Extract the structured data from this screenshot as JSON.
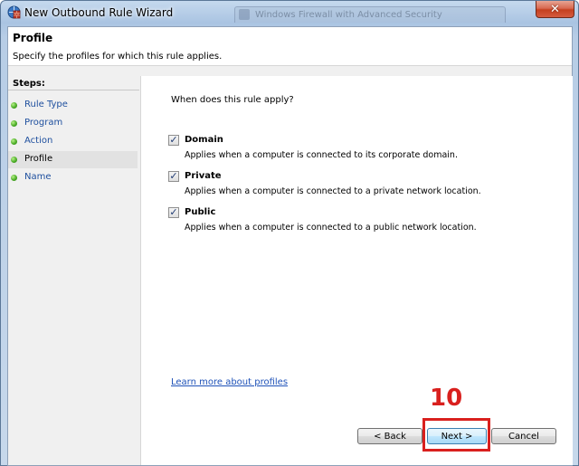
{
  "window": {
    "title": "New Outbound Rule Wizard",
    "background_window_title": "Windows Firewall with Advanced Security",
    "close_label": "✕"
  },
  "header": {
    "title": "Profile",
    "subtitle": "Specify the profiles for which this rule applies."
  },
  "steps": {
    "title": "Steps:",
    "items": [
      {
        "label": "Rule Type",
        "active": false
      },
      {
        "label": "Program",
        "active": false
      },
      {
        "label": "Action",
        "active": false
      },
      {
        "label": "Profile",
        "active": true
      },
      {
        "label": "Name",
        "active": false
      }
    ]
  },
  "main": {
    "question": "When does this rule apply?",
    "options": [
      {
        "name": "Domain",
        "description": "Applies when a computer is connected to its corporate domain.",
        "checked": true
      },
      {
        "name": "Private",
        "description": "Applies when a computer is connected to a private network location.",
        "checked": true
      },
      {
        "name": "Public",
        "description": "Applies when a computer is connected to a public network location.",
        "checked": true
      }
    ],
    "learn_more": "Learn more about profiles"
  },
  "buttons": {
    "back": "< Back",
    "next": "Next >",
    "cancel": "Cancel"
  },
  "annotation": {
    "step_number": "10",
    "color": "#d9201e"
  },
  "colors": {
    "step_dot": "#4cae28",
    "link": "#1f52b8",
    "step_link": "#1e4f9e"
  }
}
